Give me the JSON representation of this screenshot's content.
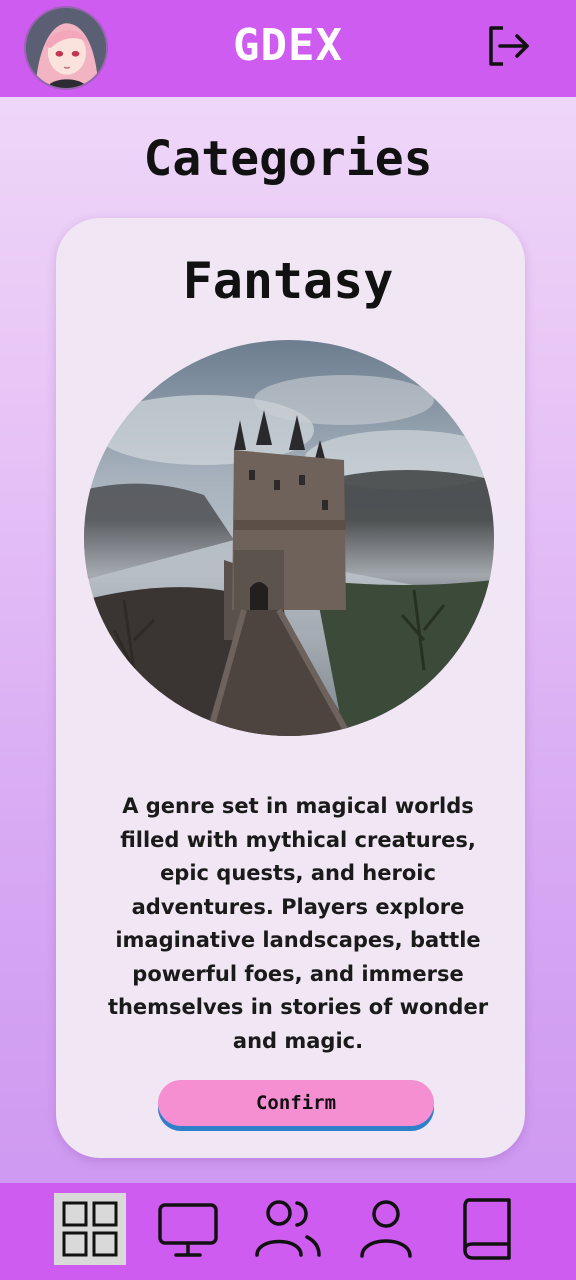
{
  "header": {
    "app_title": "GDEX",
    "avatar_icon": "profile-avatar",
    "logout_icon": "logout-icon"
  },
  "page": {
    "title": "Categories"
  },
  "category_card": {
    "title": "Fantasy",
    "image_subject": "foggy castle on a hill with stone bridge",
    "description": "A genre set in magical worlds filled with mythical creatures, epic quests, and heroic adventures. Players explore imaginative landscapes, battle powerful foes, and immerse themselves in stories of wonder and magic.",
    "confirm_label": "Confirm"
  },
  "bottom_nav": {
    "items": [
      {
        "icon": "categories-grid-icon",
        "active": true
      },
      {
        "icon": "monitor-icon",
        "active": false
      },
      {
        "icon": "users-icon",
        "active": false
      },
      {
        "icon": "user-icon",
        "active": false
      },
      {
        "icon": "book-icon",
        "active": false
      }
    ]
  },
  "colors": {
    "bar": "#cf5cf0",
    "card": "#f0e6f4",
    "confirm": "#f58fd1",
    "confirm_shadow": "#2f7fcb",
    "active_nav": "#d9d9d9"
  }
}
